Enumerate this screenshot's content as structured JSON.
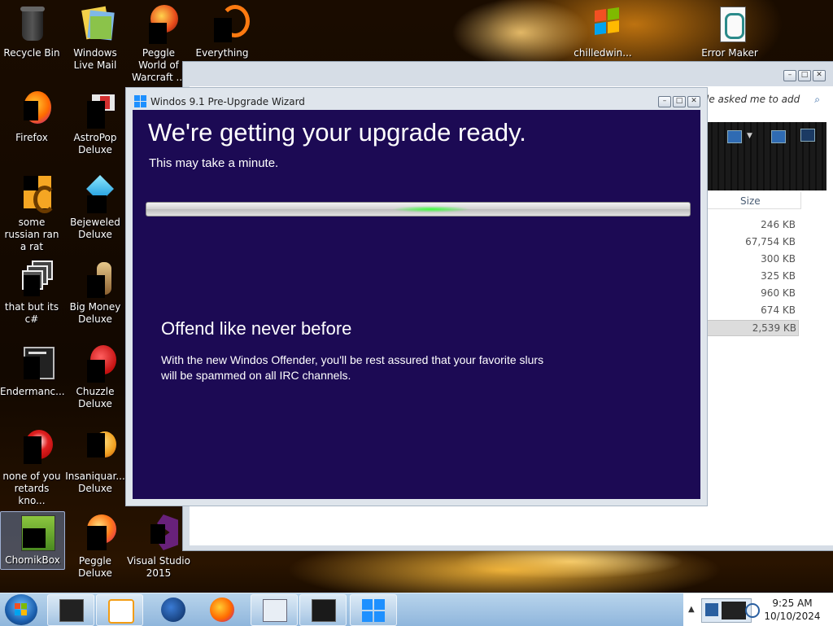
{
  "desktop": {
    "icons": [
      {
        "label": "Recycle Bin",
        "icon": "recycle-bin-icon"
      },
      {
        "label": "Windows Live Mail",
        "icon": "windows-live-mail-icon"
      },
      {
        "label": "Peggle World of Warcraft ...",
        "icon": "peggle-wow-icon"
      },
      {
        "label": "Everything",
        "icon": "everything-icon"
      },
      {
        "label": "chilledwin...",
        "icon": "windows-xp-flag-icon"
      },
      {
        "label": "Error Maker",
        "icon": "error-maker-icon"
      },
      {
        "label": "Firefox",
        "icon": "firefox-icon"
      },
      {
        "label": "AstroPop Deluxe",
        "icon": "astropop-icon"
      },
      {
        "label": "some russian ran a rat",
        "icon": "generic-app-icon"
      },
      {
        "label": "Bejeweled Deluxe",
        "icon": "bejeweled-icon"
      },
      {
        "label": "that but its c#",
        "icon": "copy-windows-icon"
      },
      {
        "label": "Big Money Deluxe",
        "icon": "big-money-icon"
      },
      {
        "label": "Endermanc...",
        "icon": "monitor-icon"
      },
      {
        "label": "Chuzzle Deluxe",
        "icon": "chuzzle-icon"
      },
      {
        "label": "none of you retards kno...",
        "icon": "red-app-icon"
      },
      {
        "label": "Insaniquar... Deluxe",
        "icon": "insaniquarium-icon"
      },
      {
        "label": "ChomikBox",
        "icon": "chomikbox-icon"
      },
      {
        "label": "Peggle Deluxe",
        "icon": "peggle-icon"
      },
      {
        "label": "Visual Studio 2015",
        "icon": "visual-studio-icon"
      }
    ]
  },
  "explorer": {
    "search_placeholder": "le asked me to add",
    "column_size": "Size",
    "sizes": [
      "246 KB",
      "67,754 KB",
      "300 KB",
      "325 KB",
      "960 KB",
      "674 KB",
      "2,539 KB"
    ],
    "selected_index": 6
  },
  "wizard": {
    "window_title": "Windos 9.1 Pre-Upgrade Wizard",
    "heading": "We're getting your upgrade ready.",
    "subheading": "This may take a minute.",
    "feature_title": "Offend like never before",
    "feature_body": "With the new Windos Offender, you'll be rest assured that your favorite slurs will be spammed on all IRC channels.",
    "accent_color": "#1c0a54",
    "progress_color": "#3cff3c"
  },
  "taskbar": {
    "pinned": [
      "monitor-app-icon",
      "media-player-icon",
      "browser-globe-icon",
      "firefox-icon",
      "calculator-icon",
      "display-app-icon",
      "windows-logo-icon"
    ],
    "time": "9:25 AM",
    "date": "10/10/2024"
  }
}
